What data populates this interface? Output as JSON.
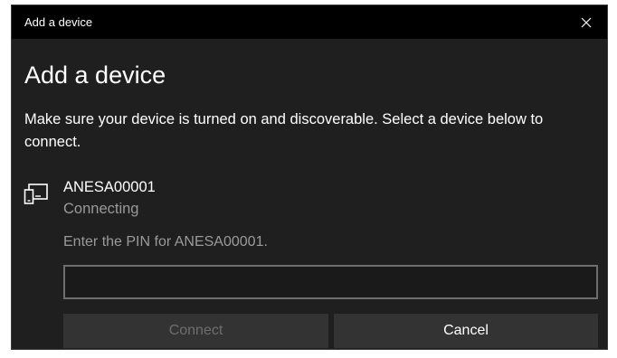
{
  "window": {
    "title": "Add a device"
  },
  "dialog": {
    "heading": "Add a device",
    "instructions": "Make sure your device is turned on and discoverable. Select a device below to connect."
  },
  "device": {
    "name": "ANESA00001",
    "status": "Connecting",
    "icon": "phone-tablet-icon"
  },
  "pin": {
    "prompt": "Enter the PIN for ANESA00001.",
    "value": "",
    "placeholder": ""
  },
  "buttons": {
    "connect_label": "Connect",
    "connect_enabled": false,
    "cancel_label": "Cancel"
  },
  "colors": {
    "titlebar": "#000000",
    "background": "#1f1f1f",
    "text": "#ffffff",
    "secondary_text": "#9a9a9a",
    "button": "#333333",
    "disabled_text": "#6e6e6e"
  }
}
